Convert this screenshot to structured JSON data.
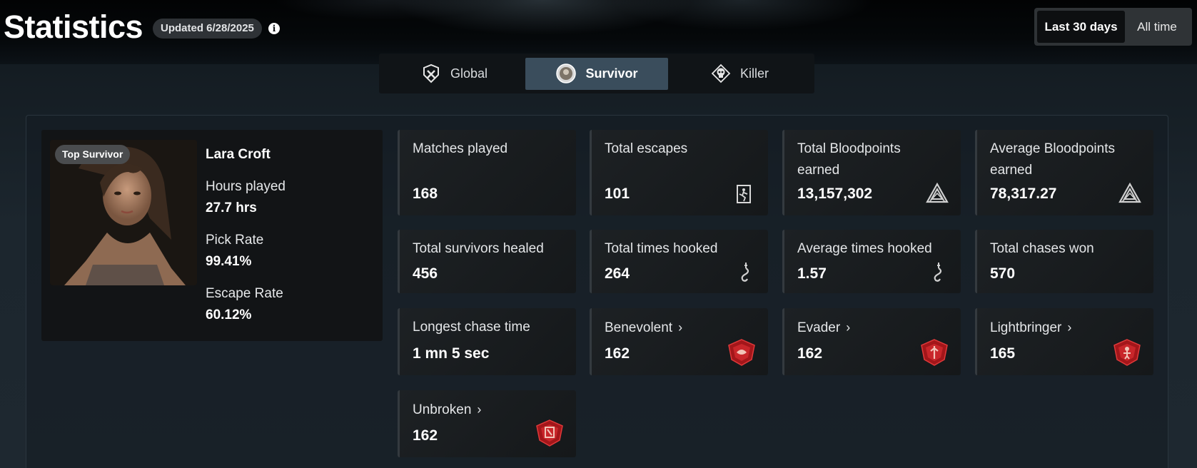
{
  "header": {
    "title": "Statistics",
    "updated": "Updated 6/28/2025",
    "info_icon": "i"
  },
  "range": {
    "options": [
      "Last 30 days",
      "All time"
    ],
    "selected": "Last 30 days"
  },
  "tabs": [
    {
      "label": "Global",
      "icon": "global-icon"
    },
    {
      "label": "Survivor",
      "icon": "survivor-icon",
      "active": true
    },
    {
      "label": "Killer",
      "icon": "killer-skull-icon"
    }
  ],
  "profile": {
    "badge": "Top Survivor",
    "name": "Lara Croft",
    "stats": [
      {
        "label": "Hours played",
        "value": "27.7 hrs"
      },
      {
        "label": "Pick Rate",
        "value": "99.41%"
      },
      {
        "label": "Escape Rate",
        "value": "60.12%"
      }
    ]
  },
  "stats": {
    "matches_played": {
      "label": "Matches played",
      "value": "168"
    },
    "total_escapes": {
      "label": "Total escapes",
      "value": "101",
      "icon": "escape-door-icon"
    },
    "total_bloodpoints": {
      "label": "Total Bloodpoints earned",
      "value": "13,157,302",
      "icon": "bloodpoints-icon"
    },
    "avg_bloodpoints": {
      "label": "Average Bloodpoints earned",
      "value": "78,317.27",
      "icon": "bloodpoints-icon"
    },
    "survivors_healed": {
      "label": "Total survivors healed",
      "value": "456"
    },
    "times_hooked": {
      "label": "Total times hooked",
      "value": "264",
      "icon": "hook-icon"
    },
    "avg_hooked": {
      "label": "Average times hooked",
      "value": "1.57",
      "icon": "hook-icon"
    },
    "chases_won": {
      "label": "Total chases won",
      "value": "570"
    },
    "longest_chase": {
      "label": "Longest chase time",
      "value": "1 mn 5 sec"
    },
    "benevolent": {
      "label": "Benevolent",
      "value": "162",
      "icon": "benevolent-emblem-icon"
    },
    "evader": {
      "label": "Evader",
      "value": "162",
      "icon": "evader-emblem-icon"
    },
    "lightbringer": {
      "label": "Lightbringer",
      "value": "165",
      "icon": "lightbringer-emblem-icon"
    },
    "unbroken": {
      "label": "Unbroken",
      "value": "162",
      "icon": "unbroken-emblem-icon"
    }
  },
  "colors": {
    "accent_tab": "#3a4d5c",
    "emblem_red": "#b3171b",
    "card_bg": "#1b1f22"
  }
}
